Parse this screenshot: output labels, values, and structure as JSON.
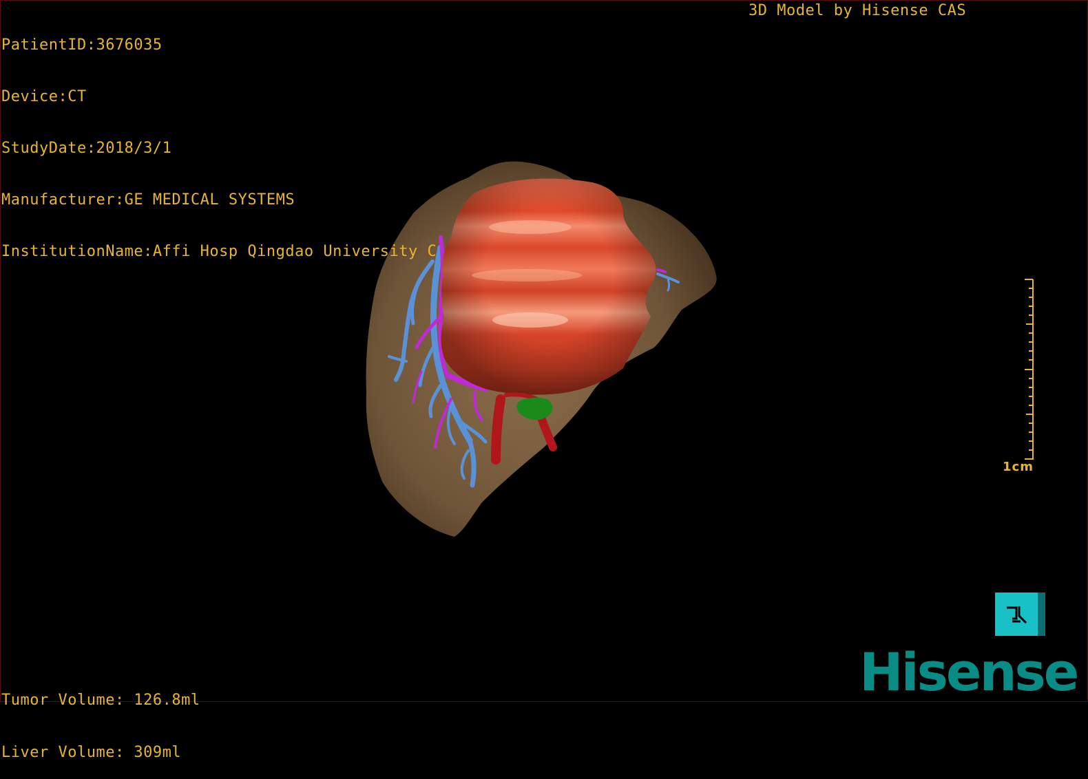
{
  "patient_info": {
    "patient_id": "PatientID:3676035",
    "device": "Device:CT",
    "study_date": "StudyDate:2018/3/1",
    "manufacturer": "Manufacturer:GE MEDICAL SYSTEMS",
    "institution": "InstitutionName:Affi Hosp Qingdao University C"
  },
  "credit": "3D Model by Hisense CAS",
  "volumes": {
    "tumor": "Tumor Volume: 126.8ml",
    "liver": "Liver Volume: 309ml"
  },
  "scale_bar": {
    "label": "1cm"
  },
  "brand": {
    "name": "Hisense",
    "color": "#0a8c86",
    "badge_color": "#17c1c6",
    "badge_icon": "view-mode-icon"
  },
  "colors": {
    "text": "#e8b530",
    "liver": "#7a5f3f",
    "tumor": "#e25531",
    "vein_blue": "#5a92d8",
    "vessel_magenta": "#c02ad6",
    "artery_red": "#b0161a",
    "gallbladder_green": "#1a8a1a"
  }
}
